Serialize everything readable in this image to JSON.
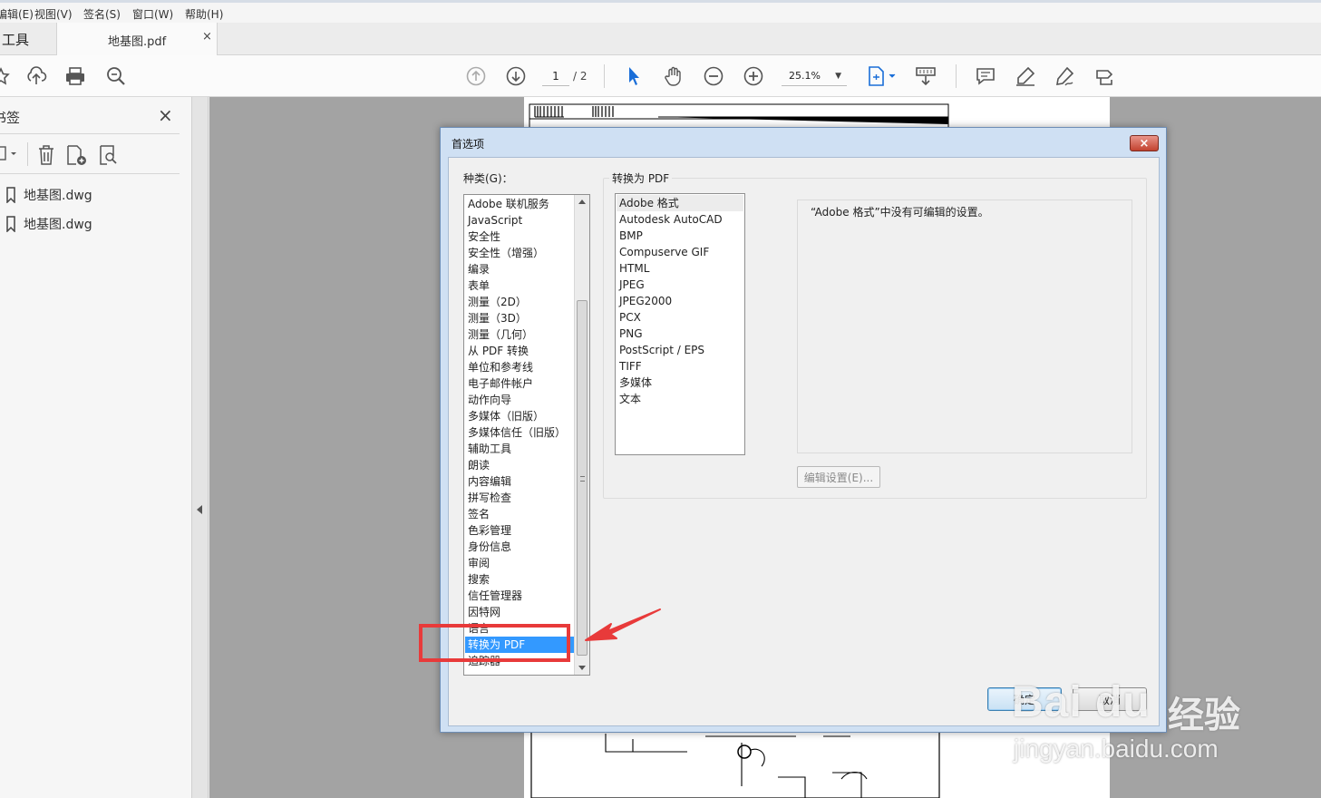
{
  "menu": [
    "编辑(E)",
    "视图(V)",
    "签名(S)",
    "窗口(W)",
    "帮助(H)"
  ],
  "tabs": {
    "tools": "工具",
    "document": "地基图.pdf",
    "close": "×"
  },
  "toolbar": {
    "page_current": "1",
    "page_total": "/ 2",
    "zoom": "25.1%",
    "icons": [
      "star-icon",
      "cloud-upload-icon",
      "print-icon",
      "search-zoom-icon",
      "page-up-icon",
      "page-down-icon",
      "select-arrow-icon",
      "hand-icon",
      "zoom-out-icon",
      "zoom-in-icon",
      "fit-page-icon",
      "scroll-mode-icon",
      "comment-icon",
      "highlight-icon",
      "sign-icon",
      "share-icon"
    ]
  },
  "left_panel": {
    "title": "书签",
    "close": "×",
    "bookmarks": [
      "地基图.dwg",
      "地基图.dwg"
    ]
  },
  "dialog": {
    "title": "首选项",
    "close": "×",
    "category_label": "种类(G)：",
    "categories": [
      "Adobe 联机服务",
      "JavaScript",
      "安全性",
      "安全性（增强）",
      "编录",
      "表单",
      "测量（2D）",
      "测量（3D）",
      "测量（几何）",
      "从 PDF 转换",
      "单位和参考线",
      "电子邮件帐户",
      "动作向导",
      "多媒体（旧版）",
      "多媒体信任（旧版）",
      "辅助工具",
      "朗读",
      "内容编辑",
      "拼写检查",
      "签名",
      "色彩管理",
      "身份信息",
      "审阅",
      "搜索",
      "信任管理器",
      "因特网",
      "语言",
      "转换为 PDF",
      "追踪器"
    ],
    "selected_category": "转换为 PDF",
    "section_label": "转换为 PDF",
    "formats": [
      "Adobe 格式",
      "Autodesk AutoCAD",
      "BMP",
      "Compuserve GIF",
      "HTML",
      "JPEG",
      "JPEG2000",
      "PCX",
      "PNG",
      "PostScript / EPS",
      "TIFF",
      "多媒体",
      "文本"
    ],
    "info_text": "“Adobe 格式”中没有可编辑的设置。",
    "edit_button": "编辑设置(E)...",
    "ok_button": "确定",
    "cancel_button": "取消"
  },
  "watermark": {
    "logo": "Bai du",
    "brand": "经验",
    "url": "jingyan.baidu.com"
  },
  "colors": {
    "selection": "#3399ff",
    "annotation_red": "#e83a3a",
    "dialog_frame": "#cfe0f3"
  }
}
